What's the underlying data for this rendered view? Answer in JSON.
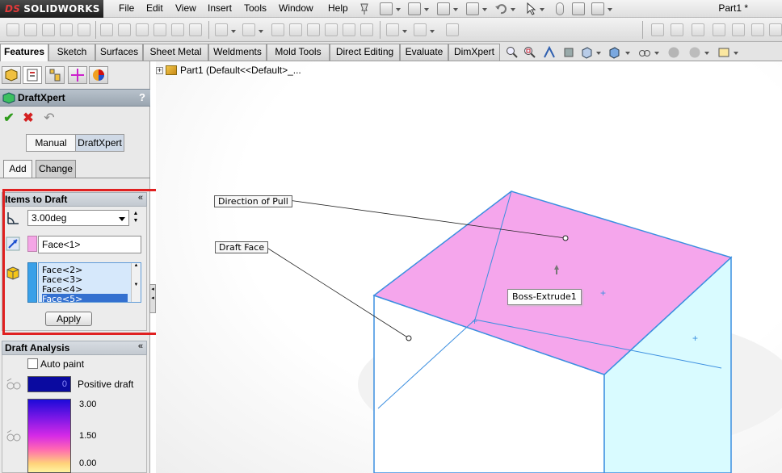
{
  "app": {
    "logo_text": "SOLIDWORKS",
    "logo_prefix": "DS",
    "document_title": "Part1 *"
  },
  "menu": [
    "File",
    "Edit",
    "View",
    "Insert",
    "Tools",
    "Window",
    "Help"
  ],
  "command_tabs": [
    "Features",
    "Sketch",
    "Surfaces",
    "Sheet Metal",
    "Weldments",
    "Mold Tools",
    "Direct Editing",
    "Evaluate",
    "DimXpert"
  ],
  "active_command_tab": "Features",
  "property_manager": {
    "title": "DraftXpert",
    "help": "?",
    "mode_manual": "Manual",
    "mode_draftxpert": "DraftXpert",
    "active_mode": "DraftXpert",
    "tab_add": "Add",
    "tab_change": "Change",
    "items_to_draft": {
      "title": "Items to Draft",
      "chevron": "«",
      "draft_angle": "3.00deg",
      "direction_of_pull": "Face<1>",
      "faces_to_draft": [
        "Face<2>",
        "Face<3>",
        "Face<4>",
        "Face<5>"
      ],
      "apply_label": "Apply"
    },
    "draft_analysis": {
      "title": "Draft Analysis",
      "auto_paint_label": "Auto paint",
      "auto_paint_checked": false,
      "positive_value": "0",
      "positive_label": "Positive draft",
      "scale_max": "3.00",
      "scale_mid": "1.50",
      "scale_min": "0.00"
    }
  },
  "graphics": {
    "tree_root": "Part1  (Default<<Default>_...",
    "callout_pull": "Direction of Pull",
    "callout_draft": "Draft Face",
    "tooltip": "Boss-Extrude1"
  },
  "colors": {
    "top_face": "#f5a6ec",
    "side_face": "#d9fbff",
    "edge": "#3c8fe0",
    "highlight": "#e02020"
  }
}
